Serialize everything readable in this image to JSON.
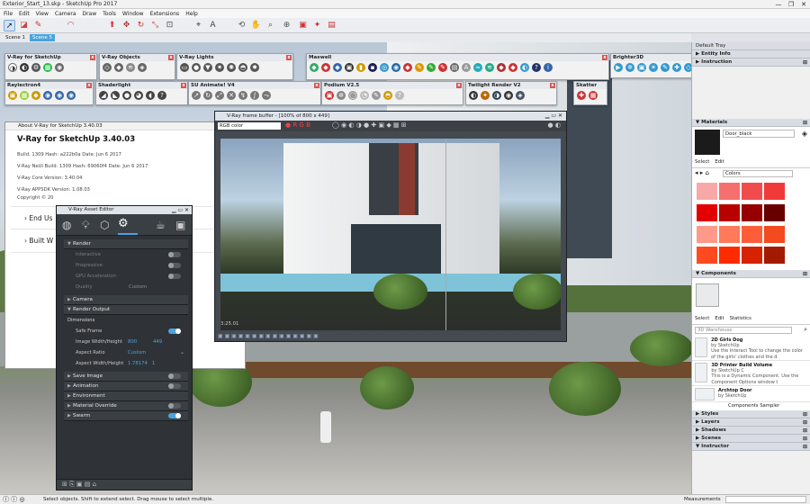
{
  "window": {
    "title": "Exterior_Start_13.skp - SketchUp Pro 2017",
    "min": "—",
    "max": "❐",
    "close": "✕"
  },
  "menu": [
    "File",
    "Edit",
    "View",
    "Camera",
    "Draw",
    "Tools",
    "Window",
    "Extensions",
    "Help"
  ],
  "scenes": [
    "Scene 1",
    "Scene 5"
  ],
  "toolbars": {
    "vray": "V-Ray for SketchUp",
    "vobj": "V-Ray Objects",
    "vlights": "V-Ray Lights",
    "maxwell": "Maxwell",
    "brighter": "Brighter3D",
    "raylectron": "Raylectron4",
    "shaderlight": "Shaderlight",
    "suanim": "SU Animate! V4",
    "podium": "Podium V2.5",
    "twilight": "Twilight Render V2",
    "skatter": "Skatter"
  },
  "about": {
    "title": "About V-Ray for SketchUp 3.40.03",
    "heading": "V-Ray for SketchUp 3.40.03",
    "lines": [
      "Build: 1309 Hash: a222b0a Date: Jun 6 2017",
      "V-Ray NeUI Build: 1309 Hash: 69060f4 Date: Jun 6 2017",
      "V-Ray Core Version: 3.40.04",
      "V-Ray APPSDK Version: 1.08.03",
      "Copyright © 20"
    ],
    "items": [
      "End Us",
      "Built W"
    ]
  },
  "vfb": {
    "title": "V-Ray frame buffer - [100% of 800 x 449]",
    "channel": "RGB color",
    "time": "3:25.01"
  },
  "editor": {
    "title": "V-Ray Asset Editor",
    "render": "Render",
    "render_rows": [
      "Interactive",
      "Progressive",
      "GPU Acceleration",
      "Quality"
    ],
    "quality_val": "Custom",
    "camera": "Camera",
    "render_output": "Render Output",
    "dimensions": "Dimensions",
    "safe_frame": "Safe Frame",
    "img_wh": "Image Width/Height",
    "w": "800",
    "h": "449",
    "aspect_ratio": "Aspect Ratio",
    "aspect_val": "Custom",
    "aspect_wh": "Aspect Width/Height",
    "aw": "1.78174",
    "ah": "1",
    "sections": [
      "Save Image",
      "Animation",
      "Environment",
      "Material Override",
      "Swarm"
    ]
  },
  "tray": {
    "title": "Default Tray",
    "entity": "Entity Info",
    "instructor": "Instruction",
    "materials": "Materials",
    "mat_name": "Door_black",
    "tab_select": "Select",
    "tab_edit": "Edit",
    "colors": "Colors",
    "components": "Components",
    "tab_stats": "Statistics",
    "search": "3D Warehouse",
    "swatches": [
      "#f9a8a8",
      "#f56f6f",
      "#f04c4c",
      "#f03a3a",
      "#e30000",
      "#b80000",
      "#960000",
      "#680000",
      "#ff9a8a",
      "#ff7a5a",
      "#ff5d3a",
      "#f34a1f",
      "#ff4a1f",
      "#ff2b00",
      "#d62200",
      "#a41a00"
    ],
    "cmp_items": [
      {
        "name": "2D Girls Dog",
        "by": "by SketchUp",
        "desc": "Use the Interact Tool to change the color of the girls' clothes and the d"
      },
      {
        "name": "3D Printer Build Volume",
        "by": "by SketchUp C",
        "desc": "This is a Dynamic Component. Use the Component Options window t"
      },
      {
        "name": "Archtop Door",
        "by": "by SketchUp",
        "desc": ""
      }
    ],
    "sampler": "Components Sampler",
    "panels": [
      "Styles",
      "Layers",
      "Shadows",
      "Scenes",
      "Instructor"
    ]
  },
  "status": {
    "hint": "Select objects. Shift to extend select. Drag mouse to select multiple.",
    "measure": "Measurements"
  },
  "colors": {
    "accent": "#4aa3df",
    "vray_dark": "#2f3337",
    "red": "#e30000"
  }
}
